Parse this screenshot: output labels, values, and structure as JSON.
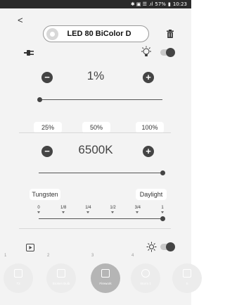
{
  "status_bar": {
    "icons_text": "✱ ▣ ☰ .ıl",
    "battery": "57%",
    "time": "10:23"
  },
  "header": {
    "back_label": "<",
    "device_name": "LED 80 BiColor D"
  },
  "power": {
    "toggle_on": true
  },
  "brightness": {
    "minus_label": "−",
    "plus_label": "+",
    "value": "1%",
    "slider_fraction": 0.01,
    "presets": [
      "25%",
      "50%",
      "100%"
    ]
  },
  "color_temp": {
    "minus_label": "−",
    "plus_label": "+",
    "value": "6500K",
    "slider_fraction": 1.0,
    "left_label": "Tungsten",
    "right_label": "Daylight",
    "ticks": [
      "0",
      "1/8",
      "1/4",
      "1/2",
      "3/4",
      "1"
    ],
    "tick_slider_fraction": 1.0
  },
  "scenes": {
    "toggle_on": true,
    "presets": [
      {
        "number": "1",
        "label": "T2",
        "selected": false
      },
      {
        "number": "2",
        "label": "Broken Bulb",
        "selected": false
      },
      {
        "number": "3",
        "label": "Firework",
        "selected": true
      },
      {
        "number": "4",
        "label": "Storm 1",
        "selected": false
      },
      {
        "number": "",
        "label": "S",
        "selected": false
      }
    ]
  },
  "colors": {
    "accent": "#444444",
    "background": "#f3f3f3",
    "status_bar": "#2b2b2b"
  }
}
